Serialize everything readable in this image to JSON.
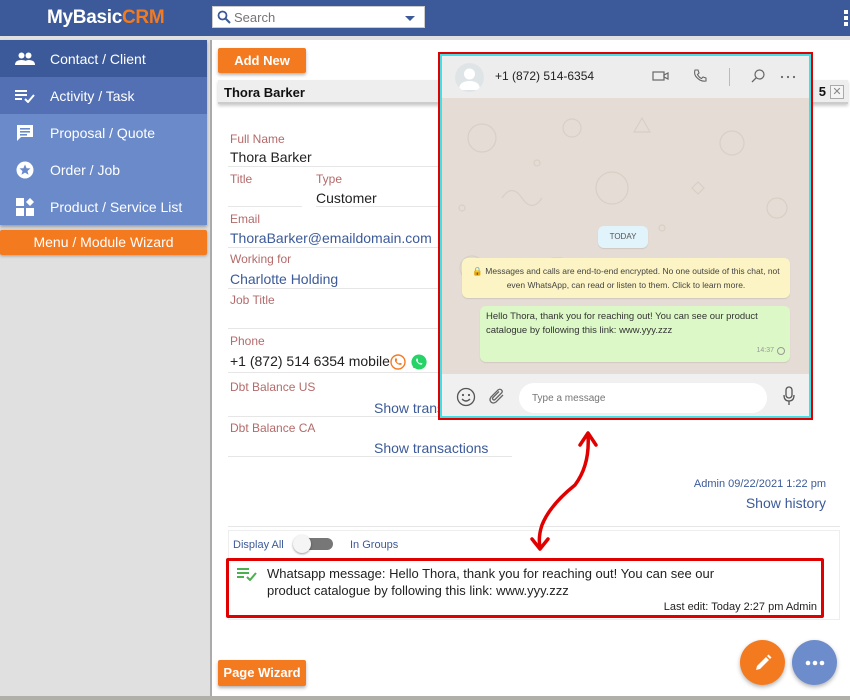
{
  "app": {
    "logo_main": "MyBasic",
    "logo_accent": "CRM",
    "search_placeholder": "Search"
  },
  "colors": {
    "brand_blue": "#3c5a99",
    "accent_orange": "#f47a20",
    "highlight_red": "#e10000",
    "whatsapp_green": "#25d366"
  },
  "sidebar": {
    "items": [
      {
        "label": "Contact / Client",
        "icon": "people-icon"
      },
      {
        "label": "Activity / Task",
        "icon": "list-check-icon"
      },
      {
        "label": "Proposal / Quote",
        "icon": "comment-icon"
      },
      {
        "label": "Order / Job",
        "icon": "star-circle-icon"
      },
      {
        "label": "Product / Service List",
        "icon": "widgets-icon"
      }
    ],
    "wizard_label": "Menu / Module Wizard"
  },
  "main": {
    "add_new_label": "Add New",
    "record_title": "Thora Barker",
    "record_number": "5",
    "close_label": "✕",
    "fields": {
      "full_name_label": "Full Name",
      "full_name": "Thora Barker",
      "title_label": "Title",
      "title_value": "",
      "type_label": "Type",
      "type_value": "Customer",
      "email_label": "Email",
      "email": "ThoraBarker@emaildomain.com",
      "working_for_label": "Working for",
      "working_for": "Charlotte Holding",
      "job_title_label": "Job Title",
      "job_title": "",
      "phone_label": "Phone",
      "phone": "+1 (872) 514 6354 mobile",
      "dbt_us_label": "Dbt Balance US",
      "dbt_us_link": "Show transactions",
      "dbt_ca_label": "Dbt Balance CA",
      "dbt_ca_link": "Show transactions"
    },
    "meta_user": "Admin",
    "meta_date": "09/22/2021 1:22 pm",
    "show_history": "Show history",
    "display_all": "Display All",
    "in_groups": "In Groups",
    "toggle_on": false,
    "activity": {
      "text": "Whatsapp message: Hello Thora, thank you for reaching out! You can see our product catalogue by following this link: www.yyy.zzz",
      "last_edit": "Last edit: Today 2:27 pm Admin"
    },
    "page_wizard_label": "Page Wizard"
  },
  "whatsapp": {
    "contact": "+1 (872) 514-6354",
    "date_chip": "TODAY",
    "encryption_notice": "🔒 Messages and calls are end-to-end encrypted. No one outside of this chat, not even WhatsApp, can read or listen to them. Click to learn more.",
    "message": "Hello Thora, thank you for reaching out! You can see our product catalogue by following this link: www.yyy.zzz",
    "message_time": "14:37",
    "input_placeholder": "Type a message"
  }
}
